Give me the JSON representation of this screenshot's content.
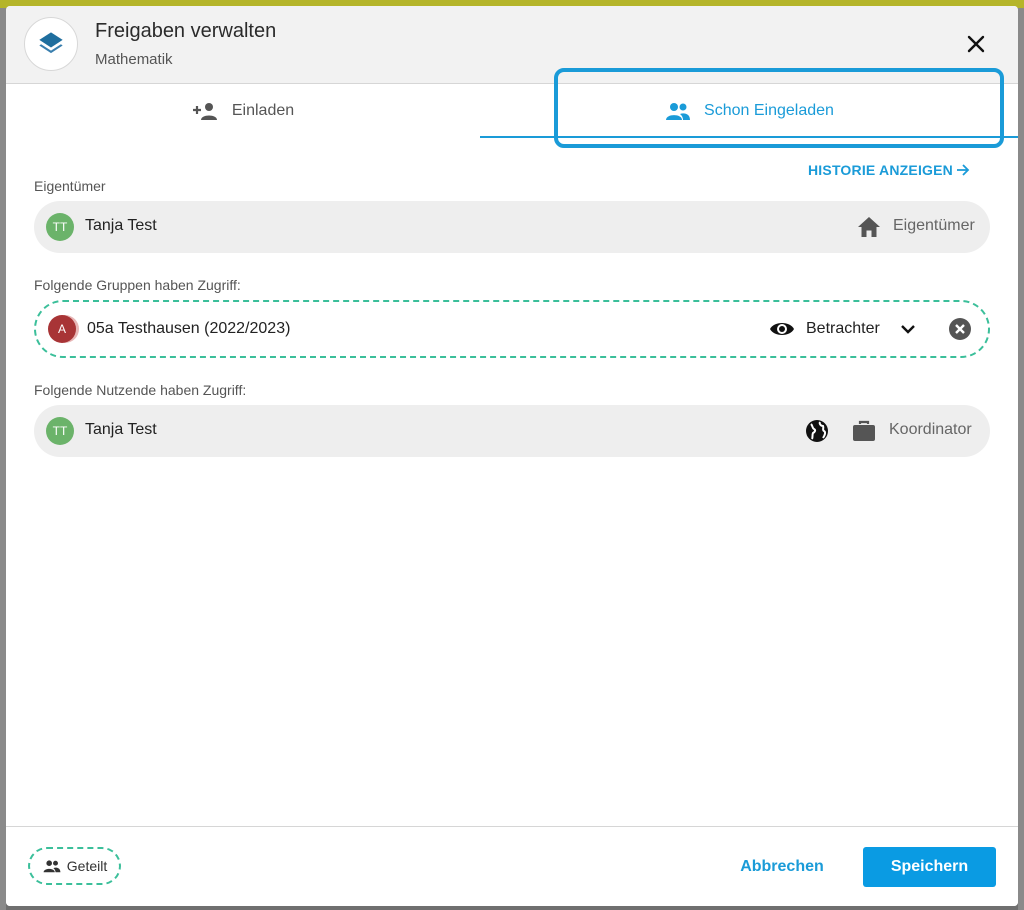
{
  "dialog": {
    "title": "Freigaben verwalten",
    "subtitle": "Mathematik",
    "app_icon": "layers-icon",
    "close_icon": "close-icon"
  },
  "tabs": [
    {
      "label": "Einladen",
      "icon": "person-add-icon",
      "active": false
    },
    {
      "label": "Schon Eingeladen",
      "icon": "people-icon",
      "active": true
    }
  ],
  "history_link": "HISTORIE ANZEIGEN",
  "owner_section": {
    "label": "Eigentümer",
    "avatar": "TT",
    "name": "Tanja Test",
    "role_icon": "home-icon",
    "role": "Eigentümer"
  },
  "groups_section": {
    "label": "Folgende Gruppen haben Zugriff:",
    "avatar": "A",
    "name": "05a Testhausen (2022/2023)",
    "role_icon": "eye-icon",
    "role": "Betrachter",
    "dropdown_icon": "chevron-down-icon",
    "remove_icon": "remove-circle-icon"
  },
  "users_section": {
    "label": "Folgende Nutzende haben Zugriff:",
    "avatar": "TT",
    "name": "Tanja Test",
    "scope_icon": "globe-icon",
    "role_icon": "briefcase-icon",
    "role": "Koordinator"
  },
  "footer": {
    "shared_label": "Geteilt",
    "cancel_label": "Abbrechen",
    "save_label": "Speichern"
  },
  "colors": {
    "accent": "#1a9bd8",
    "save_button": "#0a9be3",
    "dashed_border": "#3bbf9a",
    "avatar_green": "#6bb36a",
    "avatar_red": "#a83436",
    "top_bar": "#b5b52a"
  }
}
